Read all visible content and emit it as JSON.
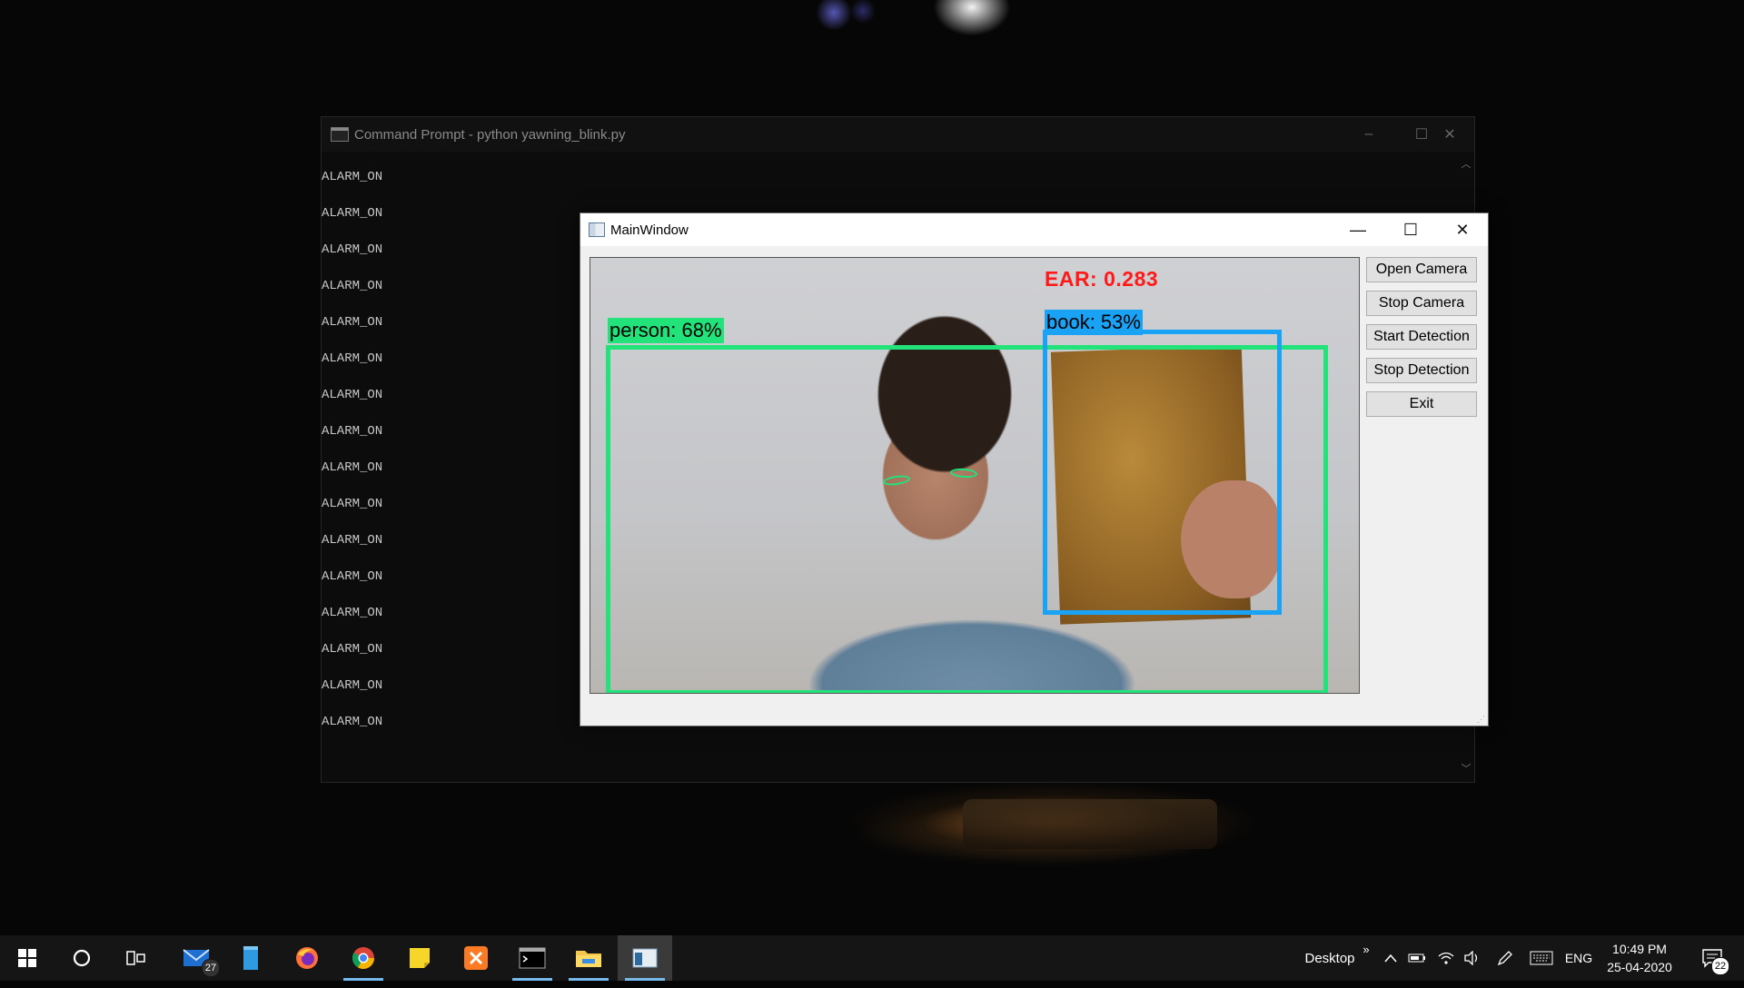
{
  "cmd": {
    "title": "Command Prompt - python  yawning_blink.py",
    "lines": [
      "ALARM_ON",
      "ALARM_ON",
      "ALARM_ON",
      "ALARM_ON",
      "ALARM_ON",
      "ALARM_ON",
      "ALARM_ON",
      "ALARM_ON",
      "ALARM_ON",
      "ALARM_ON",
      "ALARM_ON",
      "ALARM_ON",
      "ALARM_ON",
      "ALARM_ON",
      "ALARM_ON",
      "ALARM_ON"
    ],
    "controls": {
      "minimize": "–",
      "maximize": "☐",
      "close": "✕"
    }
  },
  "main_window": {
    "title": "MainWindow",
    "controls": {
      "minimize": "—",
      "maximize": "☐",
      "close": "✕"
    },
    "video": {
      "ear_label": "EAR: 0.283",
      "detections": [
        {
          "label": "person: 68%",
          "color": "#21e37a"
        },
        {
          "label": "book: 53%",
          "color": "#1aa3f5"
        }
      ]
    },
    "buttons": [
      "Open Camera",
      "Stop Camera",
      "Start Detection",
      "Stop Detection",
      "Exit"
    ]
  },
  "taskbar": {
    "mail_badge": "27",
    "desktop_label": "Desktop",
    "desktop_chevron": "»",
    "language": "ENG",
    "time": "10:49 PM",
    "date": "25-04-2020",
    "notification_badge": "22",
    "apps": [
      "start-icon",
      "cortana-icon",
      "task-view-icon",
      "mail-icon",
      "notepad-icon",
      "firefox-icon",
      "chrome-icon",
      "sticky-notes-icon",
      "xampp-icon",
      "cmd-icon",
      "file-explorer-icon",
      "qt-app-icon"
    ]
  },
  "colors": {
    "accent": "#76b9ed",
    "ear_text": "#ff1a1a"
  }
}
